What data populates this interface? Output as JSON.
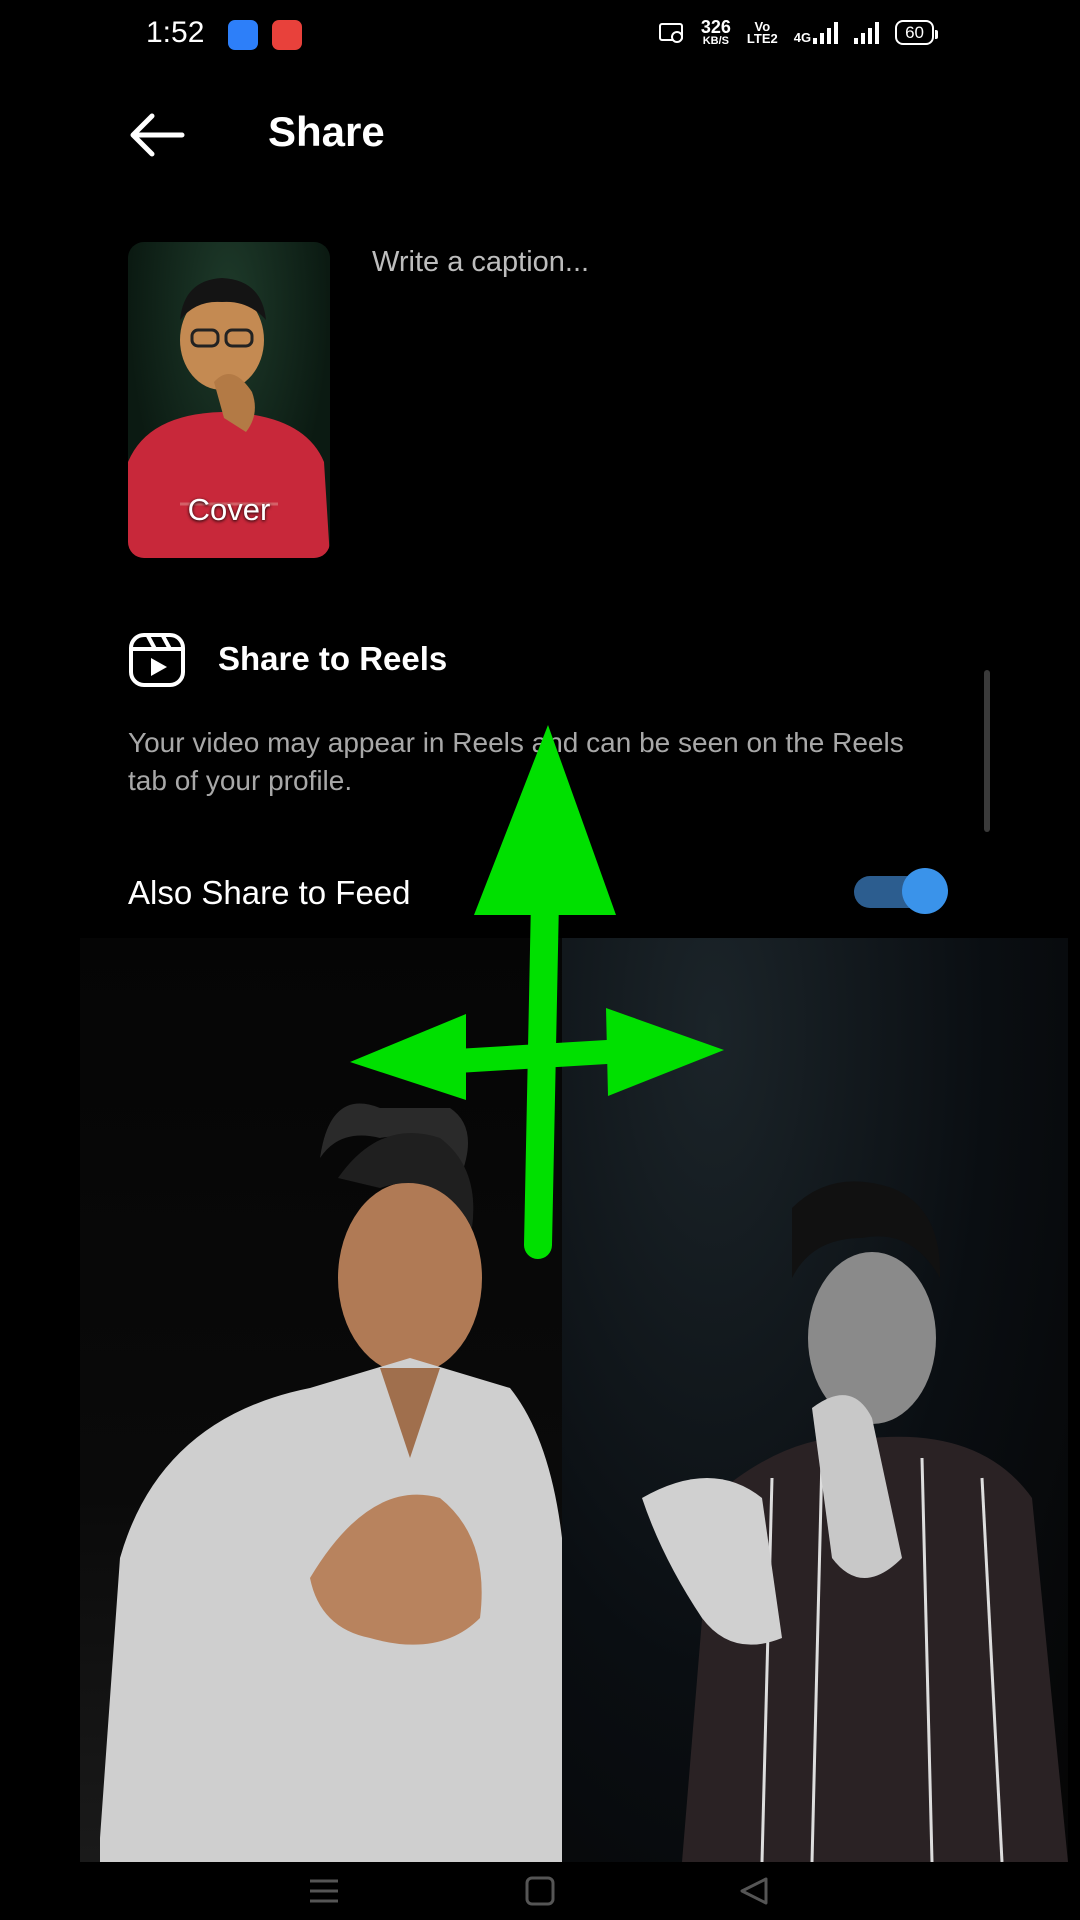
{
  "status_bar": {
    "time": "1:52",
    "net_speed": "326",
    "net_unit": "KB/S",
    "volte": "Vo",
    "volte2": "LTE2",
    "network": "4G",
    "battery": "60"
  },
  "header": {
    "back_icon": "arrow-left-icon",
    "title": "Share"
  },
  "post": {
    "cover_label": "Cover",
    "caption_placeholder": "Write a caption..."
  },
  "reels": {
    "icon": "reels-icon",
    "title": "Share to Reels",
    "description": "Your video may appear in Reels and can be seen on the Reels tab of your profile."
  },
  "feed": {
    "label": "Also Share to Feed",
    "enabled": true
  },
  "overlay": {
    "arrow_icon": "move-arrows-icon",
    "arrow_color": "#00e000"
  },
  "nav": {
    "menu_icon": "menu-icon",
    "home_icon": "home-square-icon",
    "back_icon": "back-triangle-icon"
  },
  "colors": {
    "accent": "#3a93ea",
    "toggle_track": "#2c5d8f",
    "muted_text": "#a8a8a8"
  }
}
